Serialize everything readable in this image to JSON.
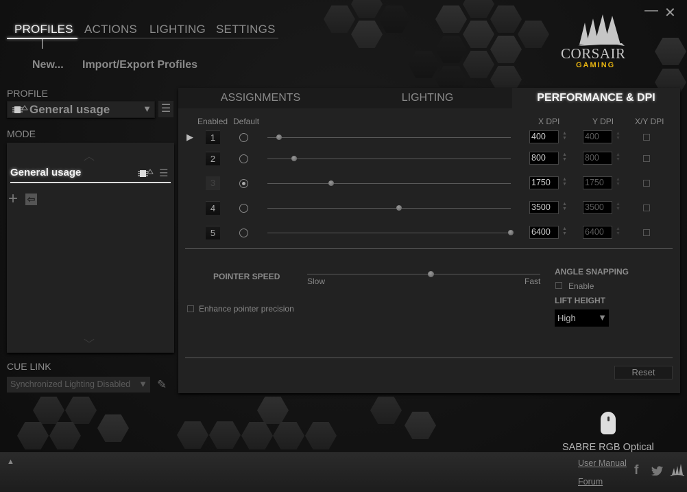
{
  "window": {
    "minimize_label": "—",
    "close_label": "✕"
  },
  "brand": {
    "name": "CORSAIR",
    "sub": "GAMING",
    "sub_color": "#E8B410"
  },
  "topnav": {
    "items": [
      {
        "label": "PROFILES",
        "active": true
      },
      {
        "label": "ACTIONS",
        "active": false
      },
      {
        "label": "LIGHTING",
        "active": false
      },
      {
        "label": "SETTINGS",
        "active": false
      }
    ],
    "sub_items": [
      {
        "label": "New..."
      },
      {
        "label": "Import/Export Profiles"
      }
    ]
  },
  "sidebar": {
    "profile_label": "PROFILE",
    "profile_value": "General usage",
    "profile_arrow": "▼",
    "menu_icon": "☰",
    "mode_label": "MODE",
    "mode_up": "︿",
    "mode_down": "﹀",
    "mode_name": "General usage",
    "mode_add": "+",
    "mode_import": "⇦",
    "cue_link_label": "CUE LINK",
    "cue_link_value": "Synchronized Lighting Disabled",
    "cue_arrow": "▼",
    "edit_icon": "✎"
  },
  "tabs": [
    {
      "label": "ASSIGNMENTS",
      "active": false
    },
    {
      "label": "LIGHTING",
      "active": false
    },
    {
      "label": "PERFORMANCE & DPI",
      "active": true
    }
  ],
  "dpi": {
    "headers": {
      "enabled": "Enabled",
      "default": "Default",
      "x": "X DPI",
      "y": "Y DPI",
      "xy": "X/Y DPI"
    },
    "range": [
      100,
      6400
    ],
    "current_stage": 1,
    "default_stage": 3,
    "stages": [
      {
        "num": "1",
        "enabled": true,
        "default": false,
        "x": "400",
        "y": "400",
        "xy_linked": false
      },
      {
        "num": "2",
        "enabled": true,
        "default": false,
        "x": "800",
        "y": "800",
        "xy_linked": false
      },
      {
        "num": "3",
        "enabled": false,
        "default": true,
        "x": "1750",
        "y": "1750",
        "xy_linked": false
      },
      {
        "num": "4",
        "enabled": true,
        "default": false,
        "x": "3500",
        "y": "3500",
        "xy_linked": false
      },
      {
        "num": "5",
        "enabled": true,
        "default": false,
        "x": "6400",
        "y": "6400",
        "xy_linked": false
      }
    ],
    "current_arrow": "▶",
    "spin_glyph": "▲▼"
  },
  "pointer": {
    "speed_label": "POINTER SPEED",
    "slow_label": "Slow",
    "fast_label": "Fast",
    "speed_fraction": 0.53,
    "enhance_label": "Enhance pointer precision",
    "enhance_checked": false
  },
  "angle_snapping": {
    "label": "ANGLE SNAPPING",
    "enable_label": "Enable",
    "enabled": false
  },
  "lift_height": {
    "label": "LIFT HEIGHT",
    "value": "High",
    "arrow": "▼"
  },
  "reset_label": "Reset",
  "device": {
    "name": "SABRE RGB Optical"
  },
  "footer": {
    "up_icon": "▲",
    "links": [
      {
        "label": "User Manual"
      },
      {
        "label": "Forum"
      }
    ],
    "social": {
      "facebook": "f",
      "twitter": "🐦"
    }
  }
}
